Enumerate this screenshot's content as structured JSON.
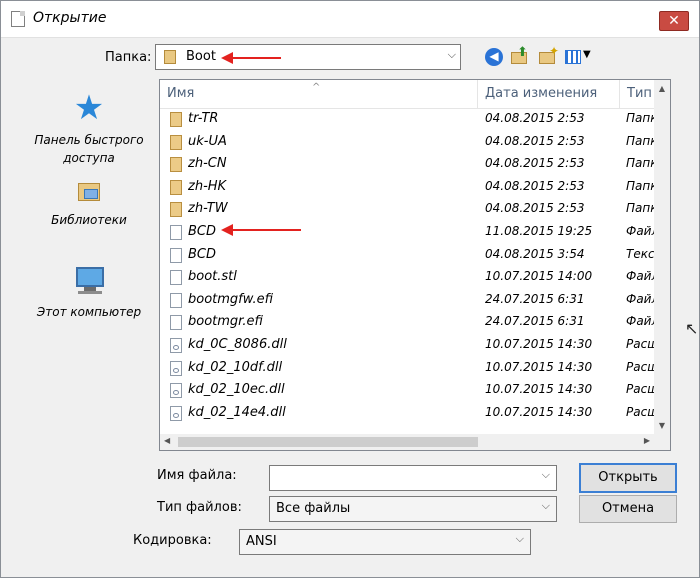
{
  "window": {
    "title": "Открытие",
    "close_label": "✕"
  },
  "lookin": {
    "label": "Папка:",
    "value": "Boot"
  },
  "toolbar": {
    "back_symbol": "◀"
  },
  "places": [
    {
      "label": "Панель быстрого доступа"
    },
    {
      "label": "Библиотеки"
    },
    {
      "label": "Этот компьютер"
    }
  ],
  "columns": {
    "name": "Имя",
    "date": "Дата изменения",
    "type": "Тип"
  },
  "files": [
    {
      "name": "tr-TR",
      "date": "04.08.2015 2:53",
      "type": "Папка",
      "kind": "folder"
    },
    {
      "name": "uk-UA",
      "date": "04.08.2015 2:53",
      "type": "Папка",
      "kind": "folder"
    },
    {
      "name": "zh-CN",
      "date": "04.08.2015 2:53",
      "type": "Папка",
      "kind": "folder"
    },
    {
      "name": "zh-HK",
      "date": "04.08.2015 2:53",
      "type": "Папка",
      "kind": "folder"
    },
    {
      "name": "zh-TW",
      "date": "04.08.2015 2:53",
      "type": "Папка",
      "kind": "folder"
    },
    {
      "name": "BCD",
      "date": "11.08.2015 19:25",
      "type": "Файл",
      "kind": "file"
    },
    {
      "name": "BCD",
      "date": "04.08.2015 3:54",
      "type": "Текст",
      "kind": "file"
    },
    {
      "name": "boot.stl",
      "date": "10.07.2015 14:00",
      "type": "Файл",
      "kind": "file"
    },
    {
      "name": "bootmgfw.efi",
      "date": "24.07.2015 6:31",
      "type": "Файл",
      "kind": "file"
    },
    {
      "name": "bootmgr.efi",
      "date": "24.07.2015 6:31",
      "type": "Файл",
      "kind": "file"
    },
    {
      "name": "kd_0C_8086.dll",
      "date": "10.07.2015 14:30",
      "type": "Расши",
      "kind": "dll"
    },
    {
      "name": "kd_02_10df.dll",
      "date": "10.07.2015 14:30",
      "type": "Расши",
      "kind": "dll"
    },
    {
      "name": "kd_02_10ec.dll",
      "date": "10.07.2015 14:30",
      "type": "Расши",
      "kind": "dll"
    },
    {
      "name": "kd_02_14e4.dll",
      "date": "10.07.2015 14:30",
      "type": "Расши",
      "kind": "dll"
    }
  ],
  "filename": {
    "label": "Имя файла:",
    "value": ""
  },
  "filetype": {
    "label": "Тип файлов:",
    "value": "Все файлы"
  },
  "encoding": {
    "label": "Кодировка:",
    "value": "ANSI"
  },
  "buttons": {
    "open": "Открыть",
    "cancel": "Отмена"
  },
  "colors": {
    "annotation_arrow": "#e3221f",
    "accent": "#3b7fd4"
  }
}
